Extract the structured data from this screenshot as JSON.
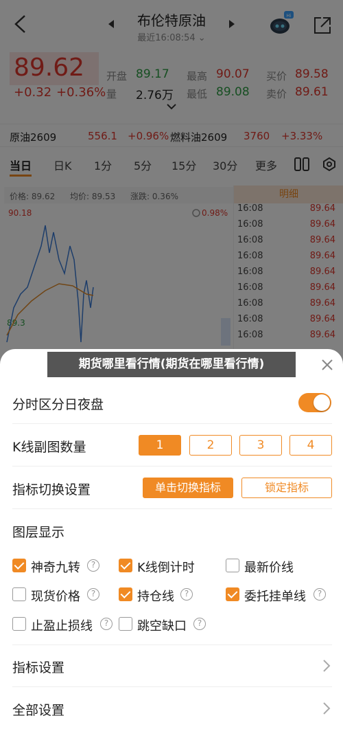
{
  "header": {
    "title": "布伦特原油",
    "subtitle": "最近16:08:54 ⌄",
    "badge": "Hi"
  },
  "quote": {
    "price": "89.62",
    "change": "+0.32",
    "change_pct": "+0.36%",
    "stats": [
      {
        "label": "开盘",
        "value": "89.17",
        "color": "#2e9e45"
      },
      {
        "label": "最高",
        "value": "90.07",
        "color": "#e0362c"
      },
      {
        "label": "买价",
        "value": "89.58",
        "color": "#e0362c"
      },
      {
        "label": "量",
        "value": "2.76万",
        "color": "#222222"
      },
      {
        "label": "最低",
        "value": "89.08",
        "color": "#2e9e45"
      },
      {
        "label": "卖价",
        "value": "89.61",
        "color": "#e0362c"
      }
    ]
  },
  "contracts": [
    {
      "name": "原油2609",
      "price": "556.1",
      "pct": "+0.96%"
    },
    {
      "name": "燃料油2609",
      "price": "3760",
      "pct": "+3.33%"
    }
  ],
  "tabs": [
    "当日",
    "日K",
    "1分",
    "5分",
    "15分",
    "30分",
    "更多"
  ],
  "chart_info": {
    "price": "价格: 89.62",
    "avg": "均价: 89.53",
    "change": "涨跌: 0.36%",
    "high": "90.18",
    "low": "89.3",
    "pct_right": "0.98%"
  },
  "detail": {
    "header": "明细",
    "rows": [
      {
        "time": "16:08",
        "price": "89.64"
      },
      {
        "time": "16:08",
        "price": "89.64"
      },
      {
        "time": "16:08",
        "price": "89.64"
      },
      {
        "time": "16:08",
        "price": "89.64"
      },
      {
        "time": "16:08",
        "price": "89.64"
      },
      {
        "time": "16:08",
        "price": "89.64"
      },
      {
        "time": "16:08",
        "price": "89.64"
      },
      {
        "time": "16:08",
        "price": "89.64"
      },
      {
        "time": "16:08",
        "price": "89.64"
      },
      {
        "time": "16:08",
        "price": "89.64"
      }
    ]
  },
  "banner": "期货哪里看行情(期货在哪里看行情)",
  "sheet": {
    "night_label": "分时区分日夜盘",
    "kline_label": "K线副图数量",
    "kline_options": [
      "1",
      "2",
      "3",
      "4"
    ],
    "kline_selected": "1",
    "indicator_switch_label": "指标切换设置",
    "indicator_switch_btn": "单击切换指标",
    "indicator_lock_btn": "锁定指标",
    "layers_label": "图层显示",
    "layers": [
      {
        "label": "神奇九转",
        "checked": true,
        "help": true
      },
      {
        "label": "K线倒计时",
        "checked": true,
        "help": false
      },
      {
        "label": "最新价线",
        "checked": false,
        "help": false
      },
      {
        "label": "现货价格",
        "checked": false,
        "help": true
      },
      {
        "label": "持仓线",
        "checked": true,
        "help": true
      },
      {
        "label": "委托挂单线",
        "checked": true,
        "help": true
      },
      {
        "label": "止盈止损线",
        "checked": false,
        "help": true
      },
      {
        "label": "跳空缺口",
        "checked": false,
        "help": true
      }
    ],
    "indicator_settings_label": "指标设置",
    "all_settings_label": "全部设置"
  },
  "colors": {
    "accent": "#f08a24",
    "up": "#e0362c",
    "down": "#2e9e45"
  }
}
